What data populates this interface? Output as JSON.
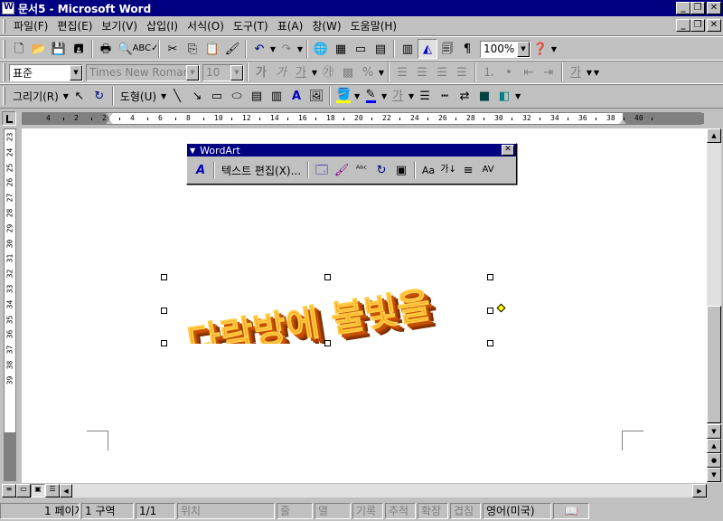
{
  "window": {
    "title": "문서5 - Microsoft Word"
  },
  "menu": [
    "파일(F)",
    "편집(E)",
    "보기(V)",
    "삽입(I)",
    "서식(O)",
    "도구(T)",
    "표(A)",
    "창(W)",
    "도움말(H)"
  ],
  "standard_toolbar": {
    "zoom": "100%"
  },
  "format_toolbar": {
    "style": "표준",
    "font": "Times New Roman",
    "size": "10"
  },
  "draw_toolbar": {
    "draw_label": "그리기(R)",
    "autoshape_label": "도형(U)"
  },
  "ruler": {
    "horizontal_labels": [
      "4",
      "2",
      "2",
      "4",
      "6",
      "8",
      "10",
      "12",
      "14",
      "16",
      "18",
      "20",
      "22",
      "24",
      "26",
      "28",
      "30",
      "32",
      "34",
      "36",
      "38",
      "40"
    ],
    "vertical_labels": [
      "23",
      "24",
      "25",
      "26",
      "27",
      "28",
      "29",
      "30",
      "31",
      "32",
      "33",
      "34",
      "35",
      "36",
      "37",
      "38",
      "39"
    ]
  },
  "wordart_toolbar": {
    "title": "WordArt",
    "edit_text": "텍스트 편집(X)..."
  },
  "wordart": {
    "text": "다락방에 불빛을"
  },
  "status": {
    "page": "1 페이지",
    "section": "1 구역",
    "page_of": "1/1",
    "position": "위치",
    "line": "줄",
    "column": "열",
    "rec": "기록",
    "trk": "추적",
    "ext": "확장",
    "ovr": "겹침",
    "language": "영어(미국)"
  },
  "colors": {
    "titlebar": "#000080",
    "wordart_face": "#ff9900",
    "wordart_side": "#b84a00"
  }
}
